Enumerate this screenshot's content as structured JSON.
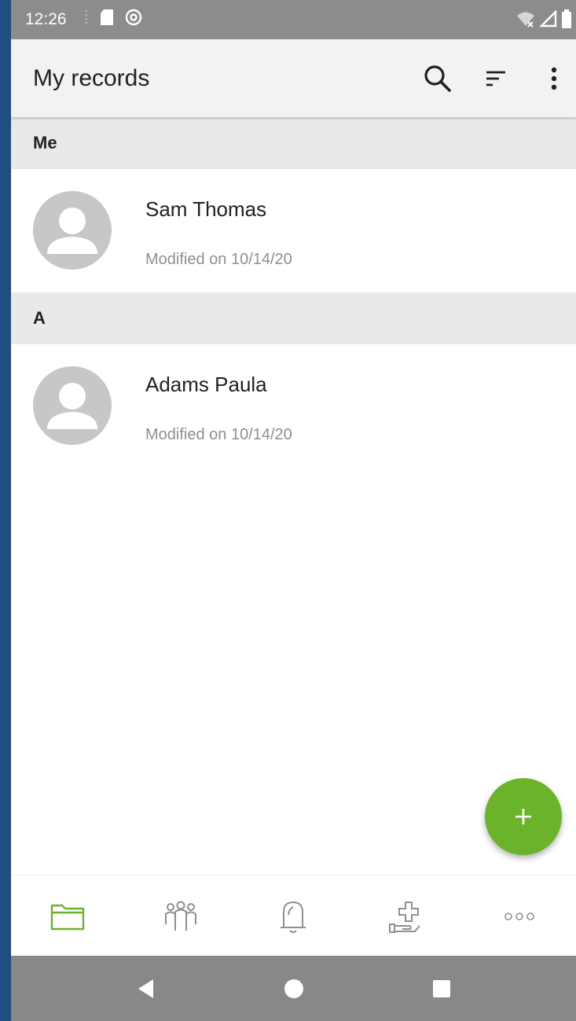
{
  "status_bar": {
    "time": "12:26",
    "left_icons": [
      "sd-card-icon",
      "at-sign-icon"
    ],
    "right_icons": [
      "wifi-icon",
      "cell-signal-icon",
      "battery-icon"
    ]
  },
  "app_bar": {
    "title": "My records",
    "actions": [
      "search-icon",
      "sort-icon",
      "more-vert-icon"
    ]
  },
  "sections": [
    {
      "header": "Me",
      "items": [
        {
          "name": "Sam Thomas",
          "modified": "Modified on 10/14/20"
        }
      ]
    },
    {
      "header": "A",
      "items": [
        {
          "name": "Adams Paula",
          "modified": "Modified on 10/14/20"
        }
      ]
    }
  ],
  "fab": {
    "icon": "plus-icon",
    "color": "#6cb32c"
  },
  "bottom_nav": {
    "items": [
      "folder-icon",
      "people-icon",
      "bell-icon",
      "medical-hand-icon",
      "more-horiz-icon"
    ],
    "active_index": 0,
    "active_color": "#6cb32c",
    "inactive_color": "#8f8f8f"
  },
  "system_nav": [
    "back-icon",
    "home-icon",
    "recents-icon"
  ]
}
